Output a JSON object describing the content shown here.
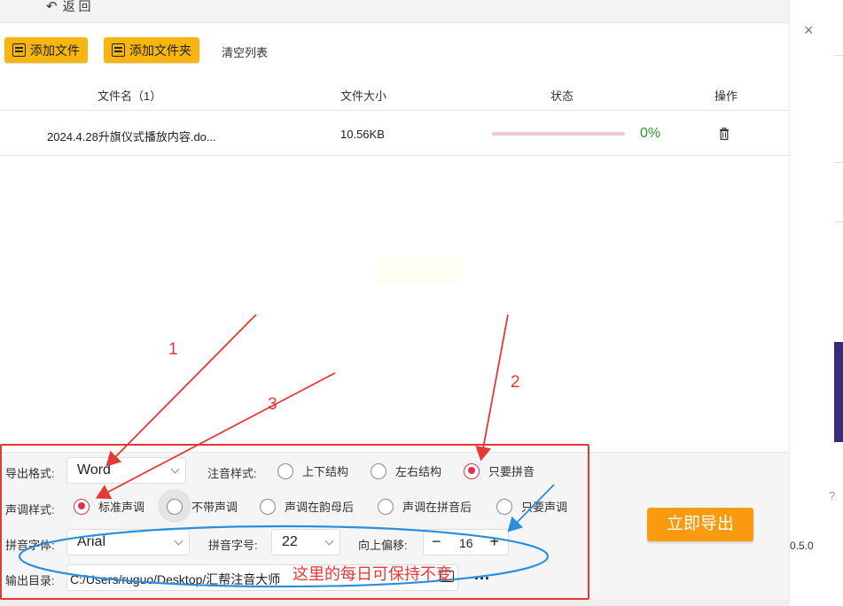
{
  "topbar": {
    "back_icon": "back-arrow-icon",
    "back_label": "返 回"
  },
  "toolbar": {
    "add_file": "添加文件",
    "add_folder": "添加文件夹",
    "clear_list": "清空列表"
  },
  "table": {
    "headers": {
      "name": "文件名（1）",
      "size": "文件大小",
      "status": "状态",
      "action": "操作"
    },
    "rows": [
      {
        "name": "2024.4.28升旗仪式播放内容.do...",
        "size": "10.56KB",
        "progress": 0,
        "progress_label": "0%"
      }
    ]
  },
  "settings": {
    "export_format_label": "导出格式:",
    "export_format_value": "Word",
    "annotation_style_label": "注音样式:",
    "annotation_options": [
      "上下结构",
      "左右结构",
      "只要拼音"
    ],
    "annotation_selected": "只要拼音",
    "tone_style_label": "声调样式:",
    "tone_options": [
      "标准声调",
      "不带声调",
      "声调在韵母后",
      "声调在拼音后",
      "只要声调"
    ],
    "tone_selected": "标准声调",
    "pinyin_font_label": "拼音字体:",
    "pinyin_font_value": "Arial",
    "pinyin_size_label": "拼音字号:",
    "pinyin_size_value": "22",
    "offset_label": "向上偏移:",
    "offset_minus": "−",
    "offset_value": "16",
    "offset_plus": "+",
    "output_dir_label": "输出目录:",
    "output_dir_value": "C:/Users/ruguo/Desktop/汇帮注音大师",
    "more": "..."
  },
  "export_button": "立即导出",
  "annotations": {
    "n1": "1",
    "n2": "2",
    "n3": "3",
    "note": "这里的每日可保持不变"
  },
  "right_panel": {
    "close": "×",
    "version": "0.5.0"
  },
  "colors": {
    "accent_yellow": "#f9b50f",
    "export_orange": "#f99b0f",
    "radio_red": "#e0314a",
    "annotation_red": "#e53935",
    "annotation_blue": "#2a8ee0",
    "progress_green": "#2e9a2e"
  }
}
